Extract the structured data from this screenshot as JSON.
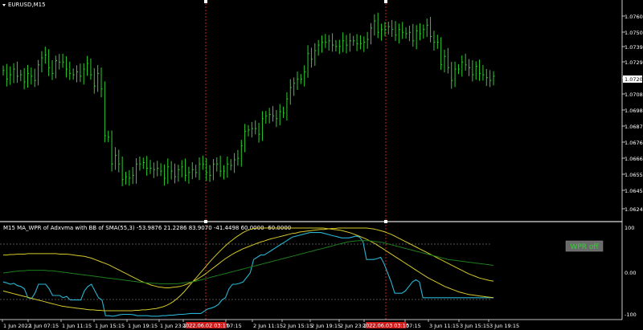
{
  "symbol": "EURUSD,M15",
  "indicator_label": "M15 MA_WPR of Adxvma with BB of SMA(55,3) -53.9876 21.2286 83.9070 -41.4498 60.0000 -60.0000",
  "wpr_button": "WPR off",
  "price_axis": [
    "1.07605",
    "1.07500",
    "1.07395",
    "1.07290",
    "1.07200",
    "1.07080",
    "1.06980",
    "1.06870",
    "1.06765",
    "1.06660",
    "1.06555",
    "1.06450",
    "1.06240"
  ],
  "current_price": "1.07200",
  "indicator_axis": [
    "100",
    "0.00",
    "-100"
  ],
  "time_axis": [
    "1 Jun 2022",
    "1 Jun 07:15",
    "1 Jun 11:15",
    "1 Jun 15:15",
    "1 Jun 19:15",
    "1 Jun 23:15",
    "2",
    "07:15",
    "2 Jun 11:15",
    "2 Jun 15:15",
    "2 Jun 19:15",
    "2 Jun 23:15",
    "3",
    "07:15",
    "3 Jun 11:15",
    "3 Jun 15:15",
    "3 Jun 19:15"
  ],
  "red_time_labels": [
    "2022.06.02 03:15",
    "2022.06.03 03:15"
  ],
  "colors": {
    "bull": "#2ecc2e",
    "wpr": "#28b4d2",
    "band": "#d4c828",
    "mid": "#1e7d1e",
    "marker": "#cc1a1a"
  },
  "chart_data": {
    "type": "line",
    "ylim": [
      1.0624,
      1.0768
    ],
    "series": [
      {
        "values": [
          1.0725,
          1.0719,
          1.0722,
          1.0726,
          1.0721,
          1.0722,
          1.0717,
          1.0723,
          1.0721,
          1.0718,
          1.0729,
          1.0734,
          1.0736,
          1.0727,
          1.0723,
          1.0732,
          1.0731,
          1.0731,
          1.0726,
          1.0723,
          1.0722,
          1.0724,
          1.0721,
          1.0726,
          1.073,
          1.0722,
          1.0714,
          1.0723,
          1.0712,
          1.0679,
          1.0678,
          1.0659,
          1.0665,
          1.0659,
          1.0648,
          1.065,
          1.0649,
          1.0651,
          1.0659,
          1.0659,
          1.066,
          1.0656,
          1.0656,
          1.0655,
          1.0656,
          1.0654,
          1.0649,
          1.0657,
          1.0654,
          1.065,
          1.0655,
          1.0657,
          1.0651,
          1.0653,
          1.0655,
          1.0653,
          1.0659,
          1.0659,
          1.0653,
          1.0651,
          1.0659,
          1.0659,
          1.0654,
          1.0654,
          1.0659,
          1.0658,
          1.0662,
          1.0663,
          1.0672,
          1.0682,
          1.0683,
          1.0684,
          1.0684,
          1.068,
          1.0691,
          1.0693,
          1.0694,
          1.0693,
          1.0691,
          1.0696,
          1.0695,
          1.0705,
          1.0713,
          1.0716,
          1.0719,
          1.0719,
          1.0724,
          1.0737,
          1.0733,
          1.0739,
          1.0743,
          1.0745,
          1.0745,
          1.0746,
          1.0743,
          1.0742,
          1.0742,
          1.0746,
          1.0743,
          1.0746,
          1.0746,
          1.0744,
          1.0744,
          1.0745,
          1.0747,
          1.0755,
          1.076,
          1.0752,
          1.0754,
          1.0754,
          1.0756,
          1.0754,
          1.075,
          1.0754,
          1.0752,
          1.0751,
          1.0752,
          1.0746,
          1.0753,
          1.0751,
          1.0754,
          1.0757,
          1.0749,
          1.0745,
          1.0745,
          1.0729,
          1.0735,
          1.0727,
          1.0718,
          1.0726,
          1.0726,
          1.0731,
          1.0729,
          1.0727,
          1.0722,
          1.0728,
          1.0723,
          1.0722,
          1.072,
          1.0718,
          1.0721
        ]
      },
      {
        "values": [
          -20,
          -22,
          -25,
          -23,
          -28,
          -30,
          -35,
          -55,
          -57,
          -45,
          -25,
          -25,
          -25,
          -35,
          -50,
          -50,
          -50,
          -55,
          -52,
          -60,
          -60,
          -60,
          -60,
          -40,
          -30,
          -25,
          -40,
          -55,
          -60,
          -95,
          -95,
          -96,
          -95,
          -93,
          -92,
          -92,
          -92,
          -93,
          -95,
          -95,
          -95,
          -95,
          -96,
          -96,
          -96,
          -95,
          -95,
          -94,
          -94,
          -93,
          -92,
          -92,
          -91,
          -90,
          -90,
          -90,
          -90,
          -85,
          -80,
          -78,
          -75,
          -70,
          -60,
          -55,
          -35,
          -25,
          -25,
          -23,
          -20,
          -10,
          0,
          30,
          35,
          40,
          40,
          45,
          50,
          55,
          60,
          65,
          70,
          75,
          80,
          82,
          84,
          86,
          88,
          90,
          90,
          90,
          90,
          88,
          86,
          84,
          82,
          80,
          78,
          78,
          78,
          80,
          82,
          80,
          70,
          30,
          30,
          30,
          32,
          35,
          20,
          0,
          -20,
          -45,
          -45,
          -45,
          -40,
          -30,
          -20,
          -15,
          -20,
          -55,
          -55,
          -55,
          -55,
          -55,
          -55,
          -55,
          -55,
          -55,
          -55,
          -55,
          -55,
          -55,
          -55,
          -55,
          -55,
          -55,
          -55,
          -55,
          -55,
          -55
        ]
      },
      {
        "values": [
          40,
          40,
          41,
          41,
          42,
          42,
          42,
          43,
          43,
          43,
          43,
          43,
          43,
          43,
          43,
          43,
          42,
          42,
          42,
          41,
          40,
          39,
          38,
          37,
          35,
          33,
          30,
          27,
          24,
          21,
          18,
          14,
          10,
          6,
          2,
          -2,
          -6,
          -10,
          -14,
          -18,
          -21,
          -24,
          -27,
          -29,
          -31,
          -32,
          -33,
          -33,
          -32,
          -31,
          -30,
          -28,
          -25,
          -22,
          -18,
          -14,
          -9,
          -4,
          2,
          8,
          14,
          20,
          26,
          32,
          37,
          42,
          46,
          50,
          54,
          57,
          60,
          63,
          66,
          69,
          71,
          74,
          76,
          78,
          80,
          82,
          84,
          86,
          88,
          89,
          91,
          92,
          93,
          94,
          95,
          96,
          97,
          97,
          98,
          99,
          99,
          100,
          100,
          100,
          100,
          100,
          100,
          100,
          100,
          100,
          99,
          98,
          96,
          94,
          92,
          89,
          86,
          82,
          78,
          74,
          70,
          66,
          62,
          58,
          54,
          50,
          46,
          42,
          38,
          34,
          30,
          26,
          22,
          18,
          14,
          10,
          6,
          2,
          -2,
          -5,
          -8,
          -11,
          -13,
          -15,
          -17,
          -18
        ]
      },
      {
        "values": [
          -40,
          -42,
          -44,
          -46,
          -48,
          -50,
          -52,
          -54,
          -56,
          -58,
          -60,
          -62,
          -64,
          -66,
          -68,
          -70,
          -72,
          -74,
          -75,
          -76,
          -77,
          -78,
          -79,
          -80,
          -81,
          -82,
          -82,
          -83,
          -83,
          -84,
          -84,
          -84,
          -84,
          -84,
          -84,
          -84,
          -84,
          -84,
          -83,
          -83,
          -82,
          -82,
          -81,
          -80,
          -79,
          -77,
          -75,
          -72,
          -68,
          -63,
          -57,
          -50,
          -42,
          -33,
          -24,
          -15,
          -6,
          3,
          12,
          21,
          30,
          38,
          46,
          54,
          61,
          68,
          74,
          80,
          85,
          90,
          94,
          97,
          99,
          100,
          100,
          100,
          100,
          100,
          100,
          100,
          100,
          100,
          100,
          100,
          100,
          100,
          100,
          100,
          100,
          100,
          100,
          100,
          100,
          99,
          98,
          97,
          96,
          95,
          93,
          91,
          89,
          86,
          83,
          80,
          77,
          73,
          69,
          65,
          60,
          55,
          50,
          45,
          40,
          35,
          30,
          25,
          20,
          15,
          10,
          5,
          0,
          -5,
          -10,
          -14,
          -18,
          -22,
          -26,
          -30,
          -33,
          -36,
          -39,
          -42,
          -44,
          -46,
          -48,
          -49,
          -50,
          -51,
          -52,
          -53,
          -54,
          -55
        ]
      },
      {
        "values": [
          0,
          1,
          2,
          3,
          4,
          5,
          5,
          6,
          6,
          6,
          6,
          6,
          6,
          5,
          5,
          4,
          3,
          2,
          1,
          0,
          -1,
          -2,
          -3,
          -4,
          -5,
          -6,
          -7,
          -8,
          -9,
          -10,
          -11,
          -12,
          -13,
          -14,
          -15,
          -16,
          -17,
          -18,
          -19,
          -20,
          -21,
          -22,
          -22,
          -23,
          -23,
          -24,
          -24,
          -24,
          -24,
          -24,
          -24,
          -23,
          -22,
          -21,
          -20,
          -19,
          -17,
          -15,
          -13,
          -11,
          -9,
          -7,
          -5,
          -3,
          -1,
          1,
          3,
          5,
          7,
          9,
          11,
          13,
          15,
          17,
          19,
          21,
          23,
          25,
          27,
          29,
          31,
          33,
          35,
          37,
          39,
          41,
          43,
          45,
          47,
          49,
          51,
          53,
          55,
          57,
          59,
          61,
          63,
          65,
          67,
          69,
          70,
          71,
          72,
          72,
          72,
          72,
          71,
          70,
          69,
          68,
          66,
          64,
          62,
          60,
          58,
          56,
          54,
          52,
          50,
          48,
          46,
          44,
          42,
          40,
          38,
          36,
          34,
          32,
          30,
          29,
          28,
          27,
          26,
          25,
          24,
          23,
          22,
          21,
          20,
          19,
          18,
          17
        ]
      }
    ]
  }
}
